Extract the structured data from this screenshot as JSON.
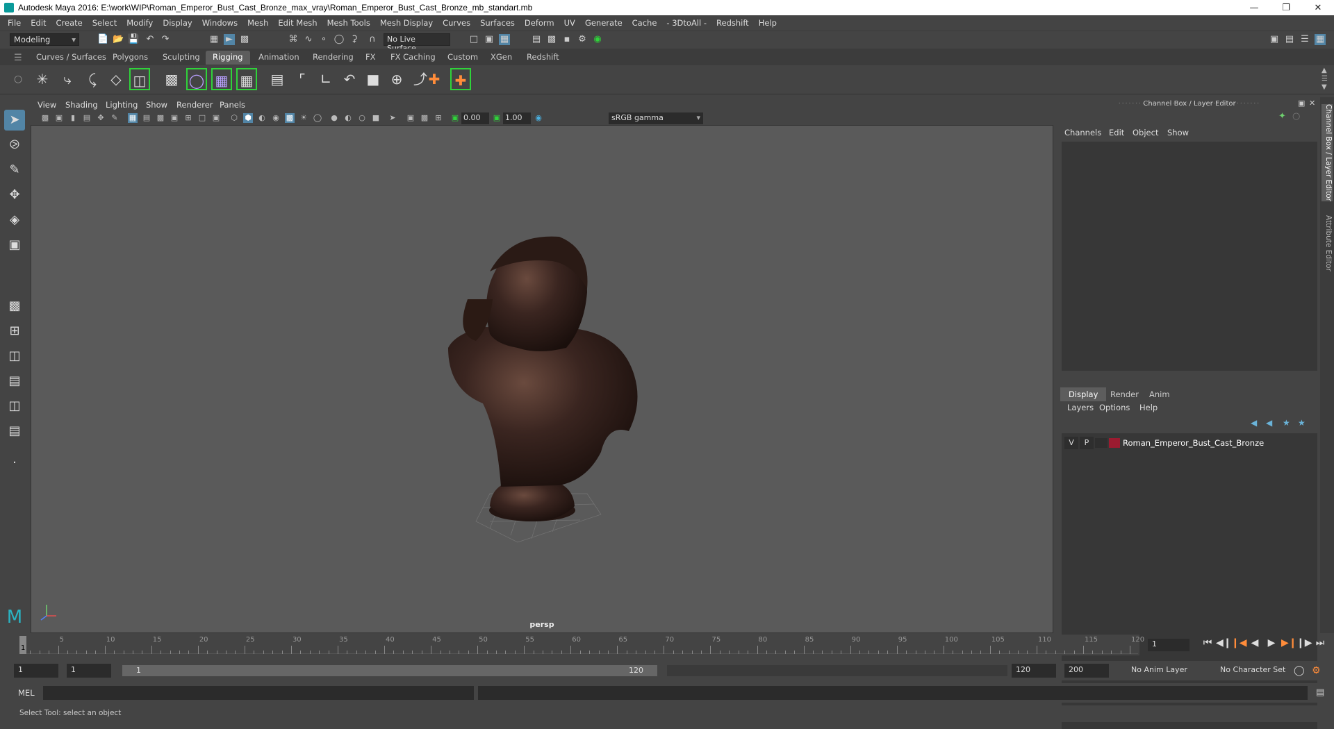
{
  "window": {
    "title": "Autodesk Maya 2016: E:\\work\\WIP\\Roman_Emperor_Bust_Cast_Bronze_max_vray\\Roman_Emperor_Bust_Cast_Bronze_mb_standart.mb"
  },
  "menubar": [
    "File",
    "Edit",
    "Create",
    "Select",
    "Modify",
    "Display",
    "Windows",
    "Mesh",
    "Edit Mesh",
    "Mesh Tools",
    "Mesh Display",
    "Curves",
    "Surfaces",
    "Deform",
    "UV",
    "Generate",
    "Cache",
    "- 3DtoAll -",
    "Redshift",
    "Help"
  ],
  "status": {
    "mode": "Modeling",
    "live_surface": "No Live Surface"
  },
  "shelf_tabs": [
    "Curves / Surfaces",
    "Polygons",
    "Sculpting",
    "Rigging",
    "Animation",
    "Rendering",
    "FX",
    "FX Caching",
    "Custom",
    "XGen",
    "Redshift"
  ],
  "active_shelf": "Rigging",
  "viewport": {
    "menus": [
      "View",
      "Shading",
      "Lighting",
      "Show",
      "Renderer",
      "Panels"
    ],
    "exposure": "0.00",
    "gamma_value": "1.00",
    "color_space": "sRGB gamma",
    "camera": "persp"
  },
  "channel_box": {
    "title": "Channel Box / Layer Editor",
    "menus": [
      "Channels",
      "Edit",
      "Object",
      "Show"
    ]
  },
  "layer_editor": {
    "tabs": [
      "Display",
      "Render",
      "Anim"
    ],
    "active_tab": "Display",
    "menus": [
      "Layers",
      "Options",
      "Help"
    ],
    "layer": {
      "v": "V",
      "p": "P",
      "name": "Roman_Emperor_Bust_Cast_Bronze",
      "color": "#9b1b30"
    }
  },
  "side_tabs": [
    "Channel Box / Layer Editor",
    "Attribute Editor"
  ],
  "timeline": {
    "ticks": [
      "5",
      "10",
      "15",
      "20",
      "25",
      "30",
      "35",
      "40",
      "45",
      "50",
      "55",
      "60",
      "65",
      "70",
      "75",
      "80",
      "85",
      "90",
      "95",
      "100",
      "105",
      "110",
      "115",
      "120"
    ],
    "current_frame_label": "1",
    "current_frame_field": "1"
  },
  "range": {
    "start": "1",
    "playback_start": "1",
    "slider_left": "1",
    "slider_right": "120",
    "playback_end": "120",
    "end": "200",
    "anim_layer": "No Anim Layer",
    "character_set": "No Character Set"
  },
  "command": {
    "label": "MEL"
  },
  "help_line": "Select Tool: select an object",
  "colors": {
    "accent": "#5285a6",
    "shelf_highlight": "#2fd33a",
    "bronze": "#3a2520"
  }
}
